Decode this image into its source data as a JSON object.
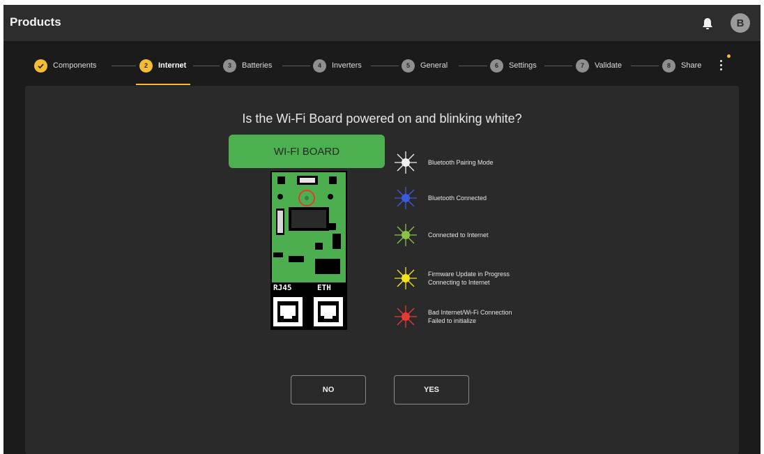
{
  "app": {
    "title": "Products",
    "avatar_initial": "B"
  },
  "colors": {
    "accent": "#f5bd34",
    "board_green": "#4caf50",
    "highlight_ring": "#e53935"
  },
  "stepper": {
    "steps": [
      {
        "label": "Components",
        "number": "1",
        "state": "done"
      },
      {
        "label": "Internet",
        "number": "2",
        "state": "active"
      },
      {
        "label": "Batteries",
        "number": "3",
        "state": "pending"
      },
      {
        "label": "Inverters",
        "number": "4",
        "state": "pending"
      },
      {
        "label": "General",
        "number": "5",
        "state": "pending"
      },
      {
        "label": "Settings",
        "number": "6",
        "state": "pending"
      },
      {
        "label": "Validate",
        "number": "7",
        "state": "pending"
      },
      {
        "label": "Share",
        "number": "8",
        "state": "pending"
      }
    ]
  },
  "main": {
    "question": "Is the Wi-Fi Board powered on and blinking white?",
    "board_title": "WI-FI BOARD",
    "port_labels": {
      "left": "RJ45",
      "right": "ETH"
    },
    "legend": [
      {
        "text": "Bluetooth Pairing Mode",
        "color": "#f2f2f2"
      },
      {
        "text": "Bluetooth Connected",
        "color": "#3a5bd9"
      },
      {
        "text": "Connected to Internet",
        "color": "#8bc34a"
      },
      {
        "text": "Firmware Update in Progress\nConnecting to Internet",
        "color": "#f2e21b"
      },
      {
        "text": "Bad Internet/Wi-Fi Connection\nFailed to initialize",
        "color": "#e53935"
      }
    ],
    "buttons": {
      "no": "NO",
      "yes": "YES"
    }
  }
}
